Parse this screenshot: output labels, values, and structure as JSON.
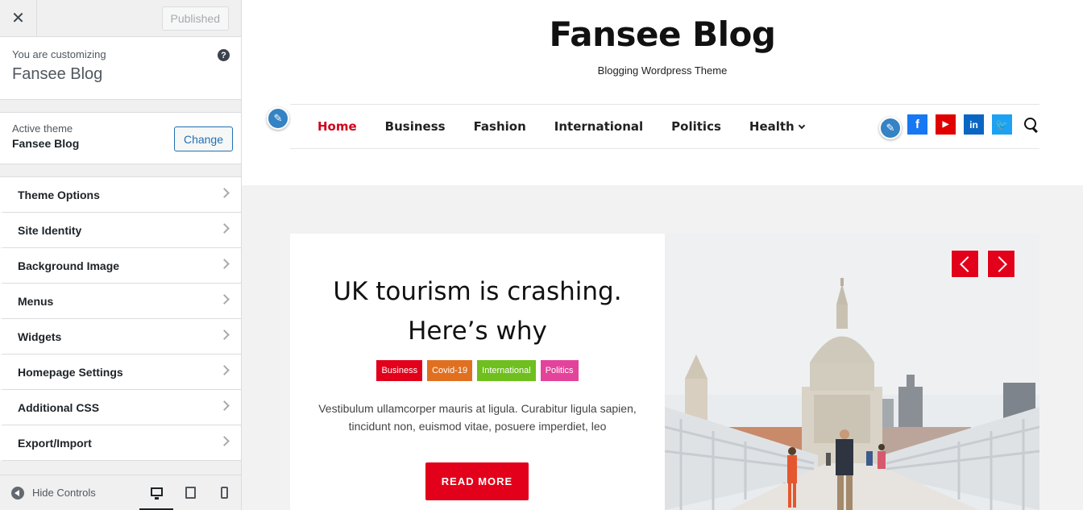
{
  "sidebar": {
    "published_label": "Published",
    "info_label": "You are customizing",
    "info_title": "Fansee Blog",
    "theme_label": "Active theme",
    "theme_name": "Fansee Blog",
    "change_label": "Change",
    "items": [
      {
        "label": "Theme Options"
      },
      {
        "label": "Site Identity"
      },
      {
        "label": "Background Image"
      },
      {
        "label": "Menus"
      },
      {
        "label": "Widgets"
      },
      {
        "label": "Homepage Settings"
      },
      {
        "label": "Additional CSS"
      },
      {
        "label": "Export/Import"
      }
    ],
    "hide_controls": "Hide Controls"
  },
  "preview": {
    "site_title": "Fansee Blog",
    "tagline": "Blogging Wordpress Theme",
    "nav": [
      "Home",
      "Business",
      "Fashion",
      "International",
      "Politics",
      "Health"
    ],
    "social": [
      "facebook-icon",
      "youtube-icon",
      "linkedin-icon",
      "twitter-icon"
    ],
    "slide": {
      "title": "UK tourism is crashing. Here’s why",
      "categories": [
        {
          "label": "Business",
          "color": "#e2001a"
        },
        {
          "label": "Covid-19",
          "color": "#e07020"
        },
        {
          "label": "International",
          "color": "#6fbf1e"
        },
        {
          "label": "Politics",
          "color": "#e3439a"
        }
      ],
      "excerpt": "Vestibulum ullamcorper mauris at ligula. Curabitur ligula sapien, tincidunt non, euismod vitae, posuere imperdiet, leo",
      "read_more": "READ MORE"
    }
  },
  "colors": {
    "accent": "#e2001a",
    "wp_blue": "#2271b1"
  }
}
